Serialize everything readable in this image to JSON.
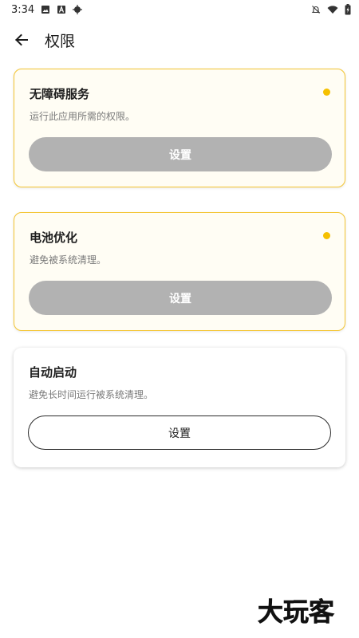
{
  "status_bar": {
    "time": "3:34",
    "left_icons": [
      "image-icon",
      "text-a-icon",
      "crosshair-icon"
    ],
    "right_icons": [
      "bell-off-icon",
      "wifi-icon",
      "battery-charging-icon"
    ]
  },
  "app_bar": {
    "title": "权限",
    "back_icon": "arrow-left-icon"
  },
  "cards": [
    {
      "title": "无障碍服务",
      "desc": "运行此应用所需的权限。",
      "button": "设置",
      "state": "pending",
      "dot_color": "#f5c000"
    },
    {
      "title": "电池优化",
      "desc": "避免被系统清理。",
      "button": "设置",
      "state": "pending",
      "dot_color": "#f5c000"
    },
    {
      "title": "自动启动",
      "desc": "避免长时间运行被系统清理。",
      "button": "设置",
      "state": "normal"
    }
  ],
  "watermark": {
    "text": "大玩客",
    "icon": "logo-watermark"
  },
  "colors": {
    "accent_border": "#f4c531",
    "pending_dot": "#f5c000",
    "disabled_button": "#b2b2b2"
  }
}
